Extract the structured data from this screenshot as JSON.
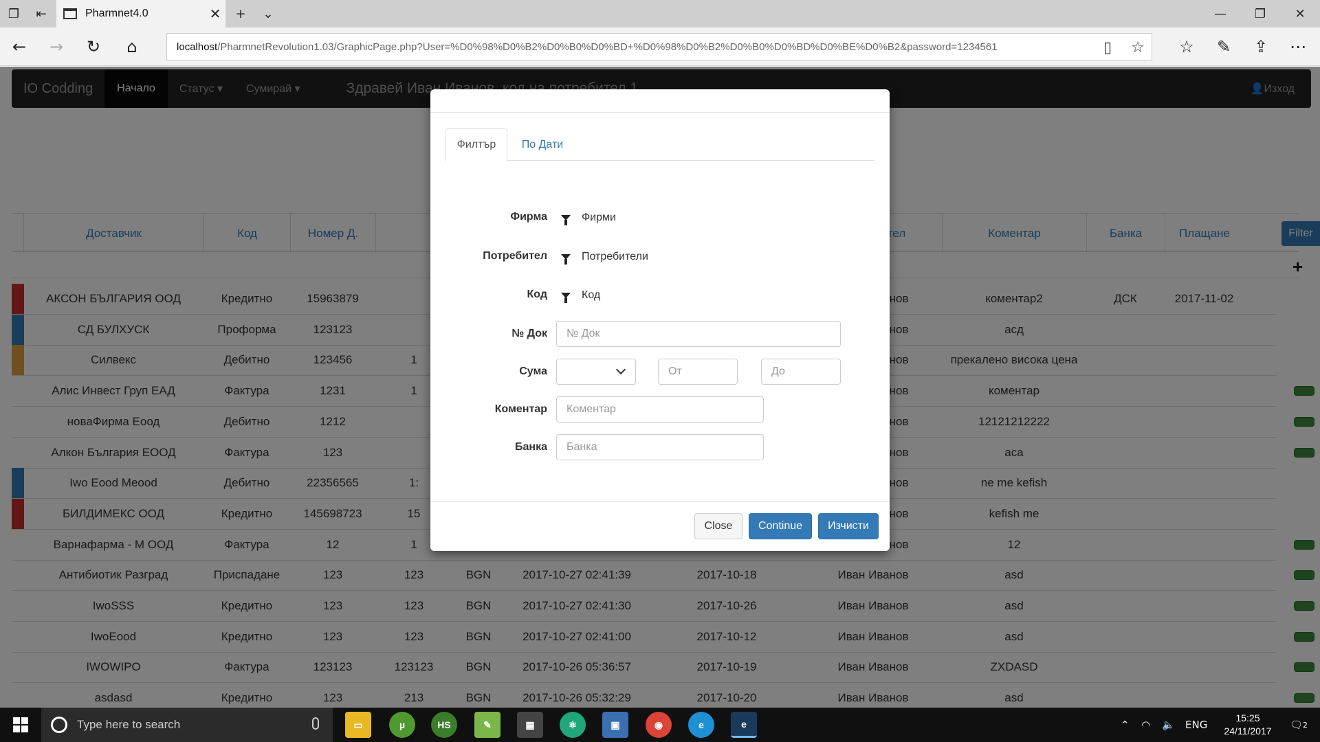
{
  "browser": {
    "tab_title": "Pharmnet4.0",
    "url_host": "localhost",
    "url_rest": "/PharmnetRevolution1.03/GraphicPage.php?User=%D0%98%D0%B2%D0%B0%D0%BD+%D0%98%D0%B2%D0%B0%D0%BD%D0%BE%D0%B2&password=1234561"
  },
  "appnav": {
    "brand": "IO Codding",
    "home": "Начало",
    "status": "Статус",
    "summary": "Сумирай",
    "greeting": "Здравей Иван Иванов, код на потребител 1",
    "logout": "Изход"
  },
  "grid": {
    "headers": [
      "Доставчик",
      "Код",
      "Номер Д.",
      "",
      "",
      "",
      "",
      "Потребител",
      "Коментар",
      "Банка",
      "Плащане"
    ],
    "filter_button": "Filter",
    "add_button": "+",
    "rows": [
      {
        "flag": "#c9302c",
        "supplier": "АКСОН БЪЛГАРИЯ ООД",
        "code": "Кредитно",
        "num": "15963879",
        "num2": "",
        "cur": "",
        "created": "",
        "date": "",
        "user": "Иван Иванов",
        "comment": "коментар2",
        "bank": "ДСК",
        "pay": "2017-11-02",
        "btn": false
      },
      {
        "flag": "#337ab7",
        "supplier": "СД БУЛХУСК",
        "code": "Проформа",
        "num": "123123",
        "num2": "",
        "cur": "",
        "created": "",
        "date": "",
        "user": "Иван Иванов",
        "comment": "асд",
        "bank": "",
        "pay": "",
        "btn": false
      },
      {
        "flag": "#e0a040",
        "supplier": "Силвекс",
        "code": "Дебитно",
        "num": "123456",
        "num2": "1",
        "cur": "",
        "created": "",
        "date": "",
        "user": "Иван Иванов",
        "comment": "прекалено висока цена",
        "bank": "",
        "pay": "",
        "btn": false
      },
      {
        "flag": "",
        "supplier": "Алис Инвест Груп ЕАД",
        "code": "Фактура",
        "num": "1231",
        "num2": "1",
        "cur": "",
        "created": "",
        "date": "",
        "user": "Иван Иванов",
        "comment": "коментар",
        "bank": "",
        "pay": "",
        "btn": true
      },
      {
        "flag": "",
        "supplier": "новаФирма Еоод",
        "code": "Дебитно",
        "num": "1212",
        "num2": "",
        "cur": "",
        "created": "",
        "date": "",
        "user": "Иван Иванов",
        "comment": "12121212222",
        "bank": "",
        "pay": "",
        "btn": true
      },
      {
        "flag": "",
        "supplier": "Алкон България ЕООД",
        "code": "Фактура",
        "num": "123",
        "num2": "",
        "cur": "",
        "created": "",
        "date": "",
        "user": "Иван Иванов",
        "comment": "аса",
        "bank": "",
        "pay": "",
        "btn": true
      },
      {
        "flag": "#337ab7",
        "supplier": "Iwo Eood Meood",
        "code": "Дебитно",
        "num": "22356565",
        "num2": "1:",
        "cur": "",
        "created": "",
        "date": "",
        "user": "Иван Иванов",
        "comment": "ne me kefish",
        "bank": "",
        "pay": "",
        "btn": false
      },
      {
        "flag": "#c9302c",
        "supplier": "БИЛДИМЕКС ООД",
        "code": "Кредитно",
        "num": "145698723",
        "num2": "15",
        "cur": "",
        "created": "",
        "date": "",
        "user": "Иван Иванов",
        "comment": "kefish me",
        "bank": "",
        "pay": "",
        "btn": false
      },
      {
        "flag": "",
        "supplier": "Варнафарма - М ООД",
        "code": "Фактура",
        "num": "12",
        "num2": "1",
        "cur": "",
        "created": "",
        "date": "",
        "user": "Иван Иванов",
        "comment": "12",
        "bank": "",
        "pay": "",
        "btn": true
      },
      {
        "flag": "",
        "supplier": "Антибиотик Разград",
        "code": "Приспадане",
        "num": "123",
        "num2": "123",
        "cur": "BGN",
        "created": "2017-10-27 02:41:39",
        "date": "2017-10-18",
        "user": "Иван Иванов",
        "comment": "asd",
        "bank": "",
        "pay": "",
        "btn": true
      },
      {
        "flag": "",
        "supplier": "IwoSSS",
        "code": "Кредитно",
        "num": "123",
        "num2": "123",
        "cur": "BGN",
        "created": "2017-10-27 02:41:30",
        "date": "2017-10-26",
        "user": "Иван Иванов",
        "comment": "asd",
        "bank": "",
        "pay": "",
        "btn": true
      },
      {
        "flag": "",
        "supplier": "IwoEood",
        "code": "Кредитно",
        "num": "123",
        "num2": "123",
        "cur": "BGN",
        "created": "2017-10-27 02:41:00",
        "date": "2017-10-12",
        "user": "Иван Иванов",
        "comment": "asd",
        "bank": "",
        "pay": "",
        "btn": true
      },
      {
        "flag": "",
        "supplier": "IWOWIPO",
        "code": "Фактура",
        "num": "123123",
        "num2": "123123",
        "cur": "BGN",
        "created": "2017-10-26 05:36:57",
        "date": "2017-10-19",
        "user": "Иван Иванов",
        "comment": "ZXDASD",
        "bank": "",
        "pay": "",
        "btn": true
      },
      {
        "flag": "",
        "supplier": "asdasd",
        "code": "Кредитно",
        "num": "123",
        "num2": "213",
        "cur": "BGN",
        "created": "2017-10-26 05:32:29",
        "date": "2017-10-20",
        "user": "Иван Иванов",
        "comment": "asd",
        "bank": "",
        "pay": "",
        "btn": true
      }
    ]
  },
  "modal": {
    "tab_filter": "Филтър",
    "tab_dates": "По Дати",
    "label_company": "Фирма",
    "company_filter": "Фирми",
    "label_user": "Потребител",
    "user_filter": "Потребители",
    "label_code": "Код",
    "code_filter": "Код",
    "label_doc": "№ Док",
    "doc_placeholder": "№ Док",
    "label_sum": "Сума",
    "from_placeholder": "От",
    "to_placeholder": "До",
    "label_comment": "Коментар",
    "comment_placeholder": "Коментар",
    "label_bank": "Банка",
    "bank_placeholder": "Банка",
    "btn_close": "Close",
    "btn_continue": "Continue",
    "btn_clear": "Изчисти"
  },
  "taskbar": {
    "search_placeholder": "Type here to search",
    "lang": "ENG",
    "time": "15:25",
    "date": "24/11/2017",
    "notifications": "2"
  }
}
